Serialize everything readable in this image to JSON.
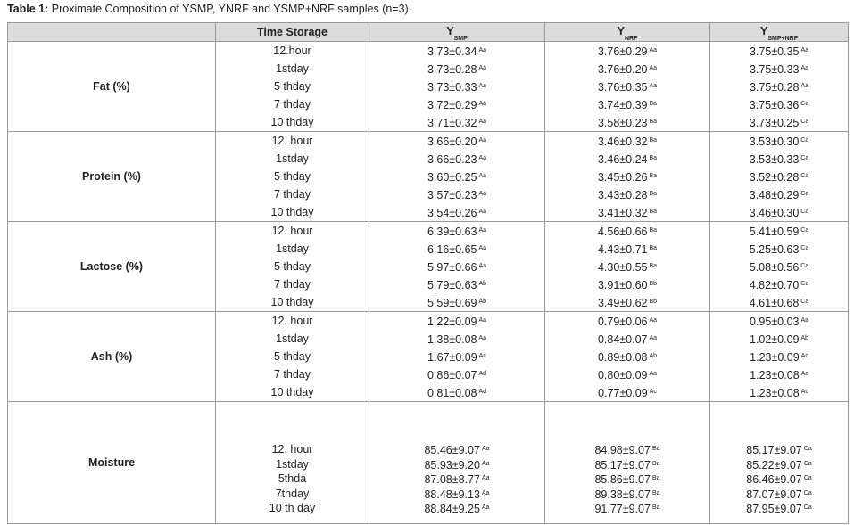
{
  "caption": {
    "label": "Table 1:",
    "text": " Proximate Composition of YSMP, YNRF and YSMP+NRF samples (n=3)."
  },
  "header": {
    "blank": "",
    "time": "Time Storage",
    "ysmp_main": "Y",
    "ysmp_sub": "SMP",
    "ynrf_main": "Y",
    "ynrf_sub": "NRF",
    "ysmpnrf_main": "Y",
    "ysmpnrf_sub": "SMP+NRF"
  },
  "groups": [
    {
      "name": "Fat (%)",
      "times": [
        "12.hour",
        "1stday",
        "5 thday",
        "7 thday",
        "10 thday"
      ],
      "ysmp": [
        [
          "3.73±0.34",
          "Aa"
        ],
        [
          "3.73±0.28",
          "Aa"
        ],
        [
          "3.73±0.33",
          "Aa"
        ],
        [
          "3.72±0.29",
          "Aa"
        ],
        [
          "3.71±0.32",
          "Aa"
        ]
      ],
      "ynrf": [
        [
          "3.76±0.29",
          "Aa"
        ],
        [
          "3.76±0.20",
          "Aa"
        ],
        [
          "3.76±0.35",
          "Aa"
        ],
        [
          "3.74±0.39",
          "Ba"
        ],
        [
          "3.58±0.23",
          "Ba"
        ]
      ],
      "ysmpnrf": [
        [
          "3.75±0.35",
          "Aa"
        ],
        [
          "3.75±0.33",
          "Aa"
        ],
        [
          "3.75±0.28",
          "Aa"
        ],
        [
          "3.75±0.36",
          "Ca"
        ],
        [
          "3.73±0.25",
          "Ca"
        ]
      ]
    },
    {
      "name": "Protein (%)",
      "times": [
        "12. hour",
        "1stday",
        "5 thday",
        "7 thday",
        "10 thday"
      ],
      "ysmp": [
        [
          "3.66±0.20",
          "Aa"
        ],
        [
          "3.66±0.23",
          "Aa"
        ],
        [
          "3.60±0.25",
          "Aa"
        ],
        [
          "3.57±0.23",
          "Aa"
        ],
        [
          "3.54±0.26",
          "Aa"
        ]
      ],
      "ynrf": [
        [
          "3.46±0.32",
          "Ba"
        ],
        [
          "3.46±0.24",
          "Ba"
        ],
        [
          "3.45±0.26",
          "Ba"
        ],
        [
          "3.43±0.28",
          "Ba"
        ],
        [
          "3.41±0.32",
          "Ba"
        ]
      ],
      "ysmpnrf": [
        [
          "3.53±0.30",
          "Ca"
        ],
        [
          "3.53±0.33",
          "Ca"
        ],
        [
          "3.52±0.28",
          "Ca"
        ],
        [
          "3.48±0.29",
          "Ca"
        ],
        [
          "3.46±0.30",
          "Ca"
        ]
      ]
    },
    {
      "name": "Lactose (%)",
      "times": [
        "12. hour",
        "1stday",
        "5 thday",
        "7 thday",
        "10 thday"
      ],
      "ysmp": [
        [
          "6.39±0.63",
          "Aa"
        ],
        [
          "6.16±0.65",
          "Aa"
        ],
        [
          "5.97±0.66",
          "Aa"
        ],
        [
          "5.79±0.63",
          "Ab"
        ],
        [
          "5.59±0.69",
          "Ab"
        ]
      ],
      "ynrf": [
        [
          "4.56±0.66",
          "Ba"
        ],
        [
          "4.43±0.71",
          "Ba"
        ],
        [
          "4.30±0.55",
          "Ba"
        ],
        [
          "3.91±0.60",
          "Bb"
        ],
        [
          "3.49±0.62",
          "Bb"
        ]
      ],
      "ysmpnrf": [
        [
          "5.41±0.59",
          "Ca"
        ],
        [
          "5.25±0.63",
          "Ca"
        ],
        [
          "5.08±0.56",
          "Ca"
        ],
        [
          "4.82±0.70",
          "Ca"
        ],
        [
          "4.61±0.68",
          "Ca"
        ]
      ]
    },
    {
      "name": "Ash (%)",
      "times": [
        "12. hour",
        "1stday",
        "5 thday",
        "7 thday",
        "10 thday"
      ],
      "ysmp": [
        [
          "1.22±0.09",
          "Aa"
        ],
        [
          "1.38±0.08",
          "Aa"
        ],
        [
          "1.67±0.09",
          "Ac"
        ],
        [
          "0.86±0.07",
          "Ad"
        ],
        [
          "0.81±0.08",
          "Ad"
        ]
      ],
      "ynrf": [
        [
          "0.79±0.06",
          "Aa"
        ],
        [
          "0.84±0.07",
          "Aa"
        ],
        [
          "0.89±0.08",
          "Ab"
        ],
        [
          "0.80±0.09",
          "Aa"
        ],
        [
          "0.77±0.09",
          "Ac"
        ]
      ],
      "ysmpnrf": [
        [
          "0.95±0.03",
          "Aa"
        ],
        [
          "1.02±0.09",
          "Ab"
        ],
        [
          "1.23±0.09",
          "Ac"
        ],
        [
          "1.23±0.08",
          "Ac"
        ],
        [
          "1.23±0.08",
          "Ac"
        ]
      ]
    },
    {
      "name": "Moisture",
      "times": [
        "12. hour",
        "1stday",
        "5thda",
        "7thday",
        "10 th day"
      ],
      "ysmp": [
        [
          "85.46±9.07",
          "Aa"
        ],
        [
          "85.93±9.20",
          "Aa"
        ],
        [
          "87.08±8.77",
          "Aa"
        ],
        [
          "88.48±9.13",
          "Aa"
        ],
        [
          "88.84±9.25",
          "Aa"
        ]
      ],
      "ynrf": [
        [
          "84.98±9.07",
          "Ba"
        ],
        [
          "85.17±9.07",
          "Ba"
        ],
        [
          "85.86±9.07",
          "Ba"
        ],
        [
          "89.38±9.07",
          "Ba"
        ],
        [
          "91.77±9.07",
          "Ba"
        ]
      ],
      "ysmpnrf": [
        [
          "85.17±9.07",
          "Ca"
        ],
        [
          "85.22±9.07",
          "Ca"
        ],
        [
          "86.46±9.07",
          "Ca"
        ],
        [
          "87.07±9.07",
          "Ca"
        ],
        [
          "87.95±9.07",
          "Ca"
        ]
      ]
    }
  ]
}
